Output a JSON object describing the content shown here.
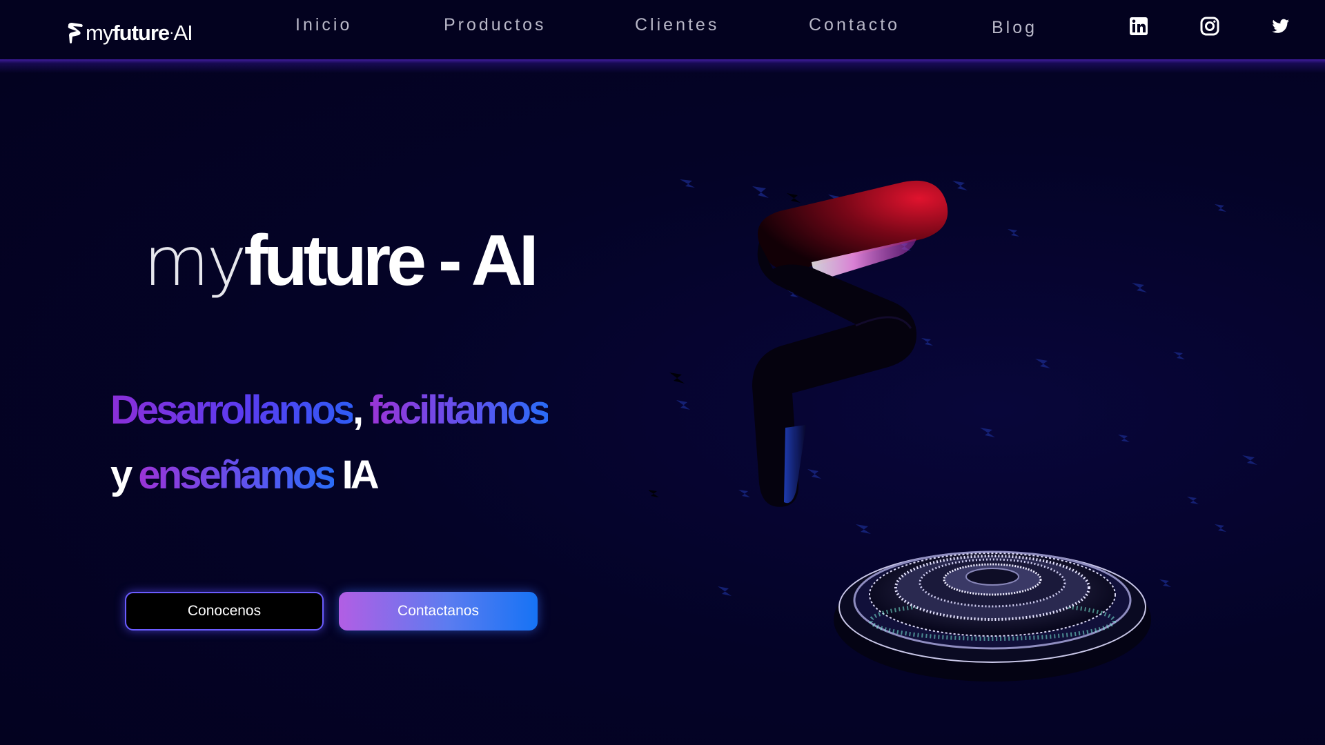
{
  "brand": {
    "logo_my": "my",
    "logo_future": "future",
    "logo_ai": "AI"
  },
  "nav": {
    "items": [
      {
        "label": "Inicio"
      },
      {
        "label": "Productos"
      },
      {
        "label": "Clientes"
      },
      {
        "label": "Contacto"
      },
      {
        "label": "Blog"
      }
    ],
    "social": [
      "linkedin-icon",
      "instagram-icon",
      "twitter-icon"
    ]
  },
  "hero": {
    "title_my": "my",
    "title_rest": "future - AI",
    "tagline": {
      "word1": "Desarrollamos",
      "comma": ",",
      "word2": "facilitamos",
      "y": "y",
      "word3": "enseñamos",
      "word4": "IA"
    },
    "buttons": {
      "primary": "Conocenos",
      "secondary": "Contactanos"
    }
  },
  "colors": {
    "background": "#03021f",
    "accent_purple": "#8b2fd8",
    "accent_blue": "#1673f5",
    "nav_text": "#b9b8c8"
  }
}
